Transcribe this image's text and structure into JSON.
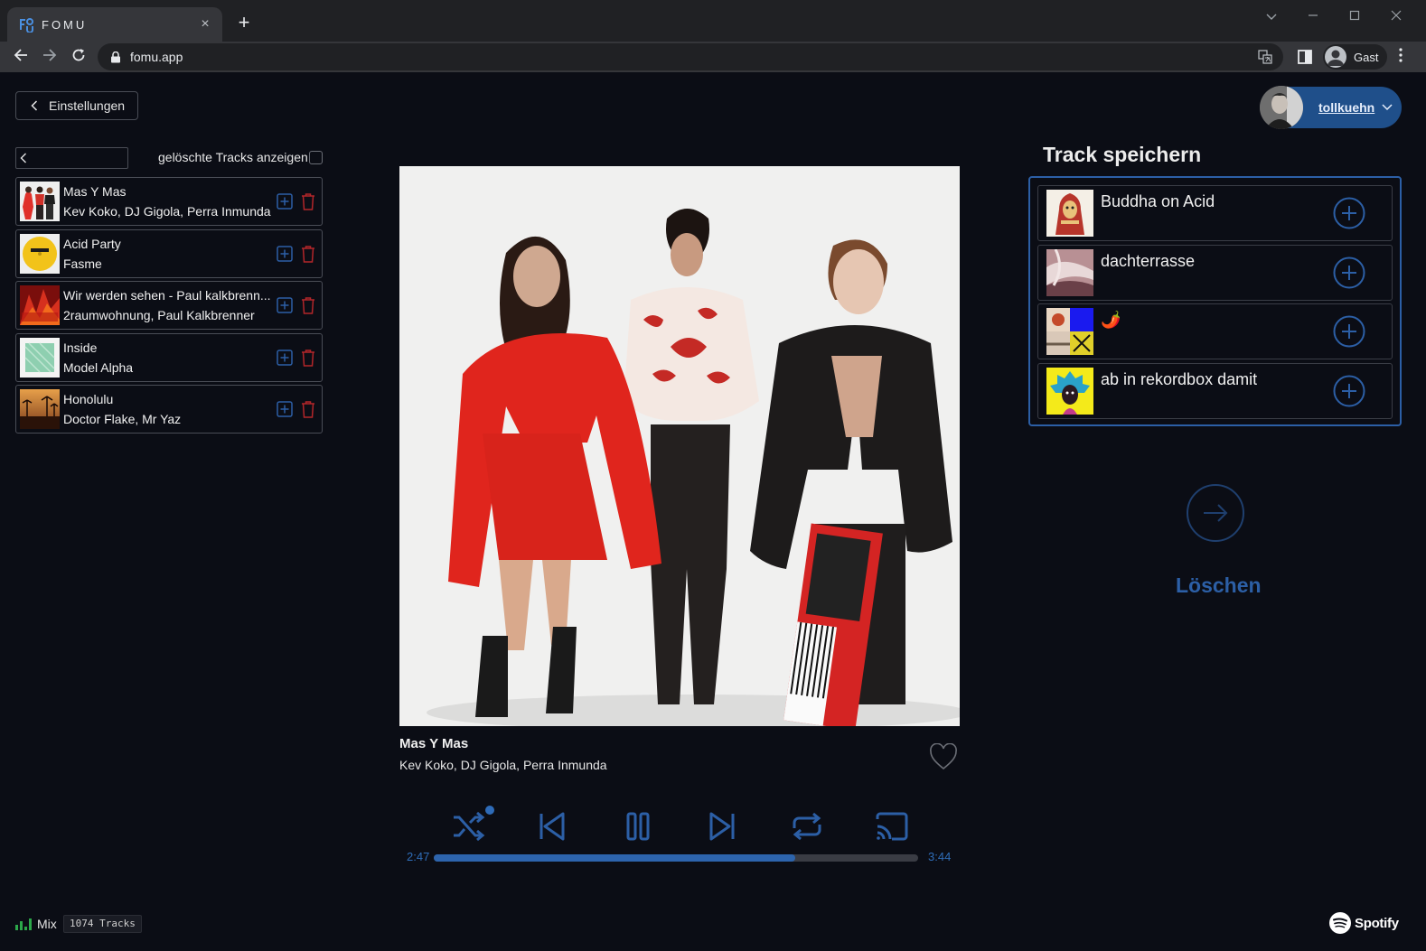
{
  "browser": {
    "tab_title": "FOMU",
    "url": "fomu.app",
    "profile_name": "Gast",
    "new_tab": "+",
    "tab_close": "×"
  },
  "header": {
    "settings_label": "Einstellungen",
    "username": "tollkuehn"
  },
  "library": {
    "show_deleted_label": "gelöschte Tracks anzeigen",
    "tracks": [
      {
        "title": "Mas Y Mas",
        "artist": "Kev Koko, DJ Gigola, Perra Inmunda"
      },
      {
        "title": "Acid Party",
        "artist": "Fasme"
      },
      {
        "title": "Wir werden sehen - Paul kalkbrenn...",
        "artist": "2raumwohnung, Paul Kalkbrenner"
      },
      {
        "title": "Inside",
        "artist": "Model Alpha"
      },
      {
        "title": "Honolulu",
        "artist": "Doctor Flake, Mr Yaz"
      }
    ]
  },
  "player": {
    "title": "Mas Y Mas",
    "artist": "Kev Koko, DJ Gigola, Perra Inmunda",
    "current_time": "2:47",
    "total_time": "3:44",
    "progress": 0.746
  },
  "save_panel": {
    "title": "Track speichern",
    "playlists": [
      {
        "name": "Buddha on Acid"
      },
      {
        "name": "dachterrasse"
      },
      {
        "name": "🌶️"
      },
      {
        "name": "ab in rekordbox damit"
      }
    ],
    "delete_label": "Löschen"
  },
  "footer": {
    "mix_label": "Mix",
    "tracks_count": "1074 Tracks",
    "brand": "Spotify"
  },
  "colors": {
    "accent": "#2c5fa6",
    "delete_red": "#b3262a",
    "background": "#0b0d15"
  }
}
